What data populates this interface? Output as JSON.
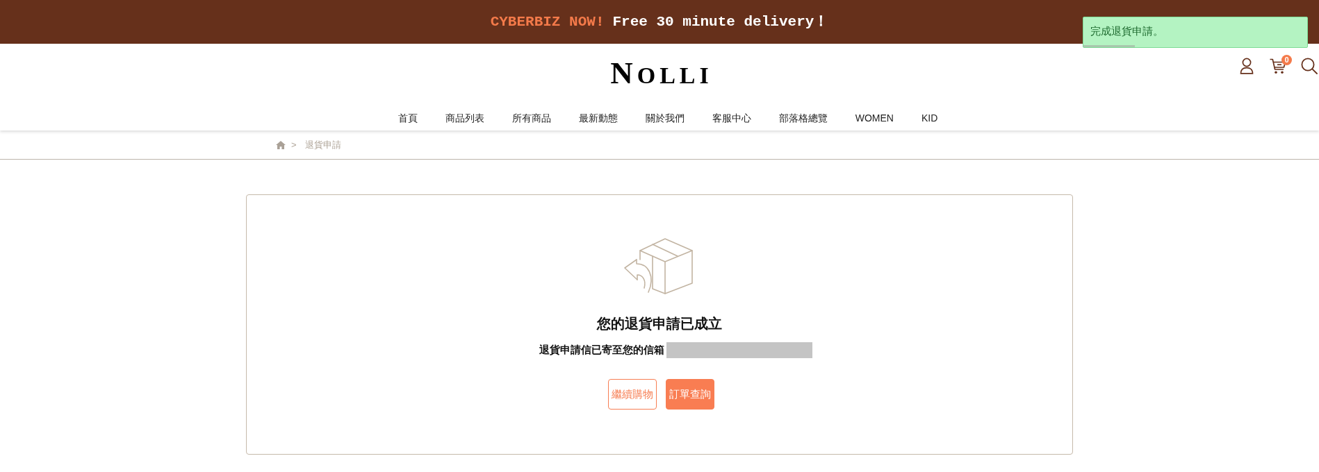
{
  "announcement": {
    "highlight": "CYBERBIZ NOW!",
    "text": "Free 30 minute delivery！"
  },
  "header": {
    "logo": "NOLLI",
    "cart_count": "0"
  },
  "nav": [
    "首頁",
    "商品列表",
    "所有商品",
    "最新動態",
    "關於我們",
    "客服中心",
    "部落格總覽",
    "WOMEN",
    "KID"
  ],
  "breadcrumb": {
    "separator": ">",
    "current": "退貨申請"
  },
  "result": {
    "title": "您的退貨申請已成立",
    "message": "退貨申請信已寄至您的信箱",
    "email_redacted": true,
    "buttons": [
      {
        "label": "繼續購物",
        "kind": "outline"
      },
      {
        "label": "訂單查詢",
        "kind": "filled"
      }
    ]
  },
  "toast": {
    "message": "完成退貨申請。",
    "level": 0.23
  }
}
